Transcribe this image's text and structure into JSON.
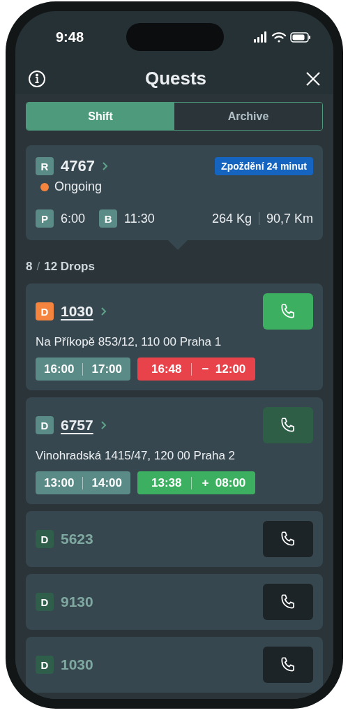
{
  "status_bar": {
    "time": "9:48"
  },
  "header": {
    "title": "Quests"
  },
  "tabs": [
    {
      "label": "Shift",
      "selected": true
    },
    {
      "label": "Archive",
      "selected": false
    }
  ],
  "route": {
    "badge": "R",
    "number": "4767",
    "delay": "Zpoždění 24 minut",
    "status": {
      "label": "Ongoing",
      "color": "#f5843f"
    },
    "pickup": {
      "badge": "P",
      "time": "6:00"
    },
    "break": {
      "badge": "B",
      "time": "11:30"
    },
    "weight": "264 Kg",
    "distance": "90,7 Km"
  },
  "drops_count": {
    "done": "8",
    "separator": "/",
    "total": "12 Drops"
  },
  "drops": [
    {
      "kind": "current",
      "badge": "D",
      "number": "1030",
      "address": "Na Příkopě 853/12, 110 00 Praha 1",
      "window": [
        "16:00",
        "17:00"
      ],
      "actual": {
        "kind": "late",
        "time": "16:48",
        "sign": "−",
        "offset": "12:00"
      }
    },
    {
      "kind": "next",
      "badge": "D",
      "number": "6757",
      "address": "Vinohradská 1415/47, 120 00 Praha 2",
      "window": [
        "13:00",
        "14:00"
      ],
      "actual": {
        "kind": "early",
        "time": "13:38",
        "sign": "+",
        "offset": "08:00"
      }
    },
    {
      "kind": "collapsed",
      "badge": "D",
      "number": "5623"
    },
    {
      "kind": "collapsed",
      "badge": "D",
      "number": "9130"
    },
    {
      "kind": "collapsed",
      "badge": "D",
      "number": "1030"
    }
  ]
}
